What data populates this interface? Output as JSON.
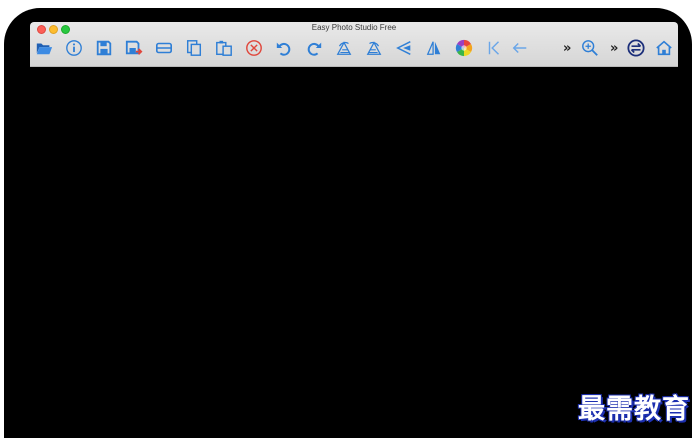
{
  "window": {
    "title": "Easy Photo Studio Free"
  },
  "toolbar": {
    "buttons": [
      {
        "icon": "open-folder-icon"
      },
      {
        "icon": "info-icon"
      },
      {
        "icon": "save-icon"
      },
      {
        "icon": "save-as-icon"
      },
      {
        "icon": "scan-icon"
      },
      {
        "icon": "copy-icon"
      },
      {
        "icon": "paste-icon"
      },
      {
        "icon": "delete-icon"
      },
      {
        "icon": "undo-icon"
      },
      {
        "icon": "redo-icon"
      },
      {
        "icon": "rotate-left-icon"
      },
      {
        "icon": "rotate-right-icon"
      },
      {
        "icon": "flip-horizontal-icon"
      },
      {
        "icon": "flip-vertical-icon"
      },
      {
        "icon": "color-wheel-icon"
      },
      {
        "icon": "first-icon"
      },
      {
        "icon": "back-arrow-icon"
      },
      {
        "icon": "zoom-in-icon"
      },
      {
        "icon": "swap-icon"
      },
      {
        "icon": "home-icon"
      }
    ],
    "overflow_label_1": "»",
    "overflow_label_2": "»"
  },
  "watermark": {
    "text": "最需教育"
  },
  "colors": {
    "icon_blue": "#2f7fd6",
    "delete_red": "#e0473c",
    "canvas": "#000000",
    "toolbar_bg": "#dcdcdc",
    "watermark_outline": "#1c2fb0"
  }
}
